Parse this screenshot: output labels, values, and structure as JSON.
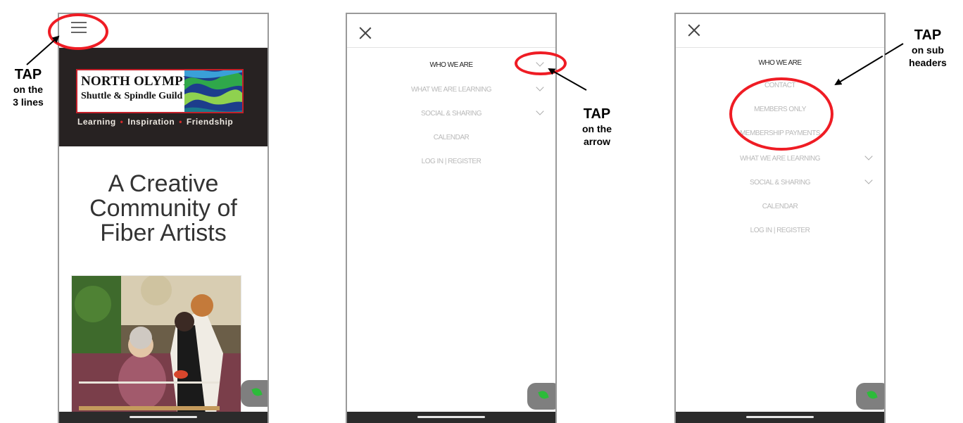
{
  "screen1": {
    "menu_icon": "hamburger-icon",
    "logo": {
      "title": "NORTH OLYMPIC",
      "subtitle": "Shuttle & Spindle Guild",
      "tagline": [
        "Learning",
        "Inspiration",
        "Friendship"
      ]
    },
    "headline": [
      "A Creative",
      "Community of",
      "Fiber Artists"
    ]
  },
  "screen2": {
    "close_icon": "close-icon",
    "menu": [
      "WHO WE ARE",
      "WHAT WE ARE LEARNING",
      "SOCIAL & SHARING",
      "CALENDAR",
      "LOG IN | REGISTER"
    ]
  },
  "screen3": {
    "close_icon": "close-icon",
    "menu": [
      "WHO WE ARE",
      "CONTACT",
      "MEMBERS ONLY",
      "MEMBERSHIP PAYMENTS",
      "WHAT WE ARE LEARNING",
      "SOCIAL & SHARING",
      "CALENDAR",
      "LOG IN | REGISTER"
    ]
  },
  "annotations": {
    "a1": {
      "title": "TAP",
      "lines": [
        "on the",
        "3 lines"
      ]
    },
    "a2": {
      "title": "TAP",
      "lines": [
        "on the",
        "arrow"
      ]
    },
    "a3": {
      "title": "TAP",
      "lines": [
        "on sub",
        "headers"
      ]
    }
  },
  "colors": {
    "highlight": "#ef1c24",
    "banner": "#272222",
    "chat": "#2dbb3a"
  }
}
